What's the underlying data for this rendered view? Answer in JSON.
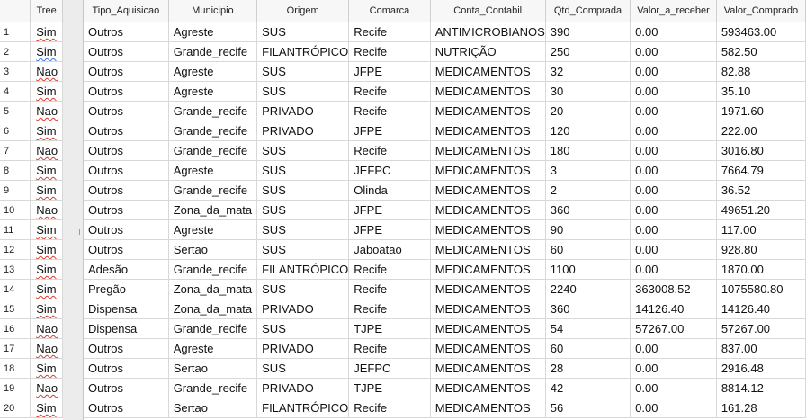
{
  "left_panel": {
    "header": "Tree",
    "rows": [
      {
        "n": "1",
        "v": "Sim"
      },
      {
        "n": "2",
        "v": "Sim"
      },
      {
        "n": "3",
        "v": "Nao"
      },
      {
        "n": "4",
        "v": "Sim"
      },
      {
        "n": "5",
        "v": "Nao"
      },
      {
        "n": "6",
        "v": "Sim"
      },
      {
        "n": "7",
        "v": "Nao"
      },
      {
        "n": "8",
        "v": "Sim"
      },
      {
        "n": "9",
        "v": "Sim"
      },
      {
        "n": "10",
        "v": "Nao"
      },
      {
        "n": "11",
        "v": "Sim"
      },
      {
        "n": "12",
        "v": "Sim"
      },
      {
        "n": "13",
        "v": "Sim"
      },
      {
        "n": "14",
        "v": "Sim"
      },
      {
        "n": "15",
        "v": "Sim"
      },
      {
        "n": "16",
        "v": "Nao"
      },
      {
        "n": "17",
        "v": "Nao"
      },
      {
        "n": "18",
        "v": "Sim"
      },
      {
        "n": "19",
        "v": "Nao"
      },
      {
        "n": "20",
        "v": "Sim"
      }
    ]
  },
  "table": {
    "columns": [
      "Tipo_Aquisicao",
      "Municipio",
      "Origem",
      "Comarca",
      "Conta_Contabil",
      "Qtd_Comprada",
      "Valor_a_receber",
      "Valor_Comprado"
    ],
    "rows": [
      [
        "Outros",
        "Agreste",
        "SUS",
        "Recife",
        "ANTIMICROBIANOS",
        "390",
        "0.00",
        "593463.00"
      ],
      [
        "Outros",
        "Grande_recife",
        "FILANTRÓPICO",
        "Recife",
        "NUTRIÇÃO",
        "250",
        "0.00",
        "582.50"
      ],
      [
        "Outros",
        "Agreste",
        "SUS",
        "JFPE",
        "MEDICAMENTOS",
        "32",
        "0.00",
        "82.88"
      ],
      [
        "Outros",
        "Agreste",
        "SUS",
        "Recife",
        "MEDICAMENTOS",
        "30",
        "0.00",
        "35.10"
      ],
      [
        "Outros",
        "Grande_recife",
        "PRIVADO",
        "Recife",
        "MEDICAMENTOS",
        "20",
        "0.00",
        "1971.60"
      ],
      [
        "Outros",
        "Grande_recife",
        "PRIVADO",
        "JFPE",
        "MEDICAMENTOS",
        "120",
        "0.00",
        "222.00"
      ],
      [
        "Outros",
        "Grande_recife",
        "SUS",
        "Recife",
        "MEDICAMENTOS",
        "180",
        "0.00",
        "3016.80"
      ],
      [
        "Outros",
        "Agreste",
        "SUS",
        "JEFPC",
        "MEDICAMENTOS",
        "3",
        "0.00",
        "7664.79"
      ],
      [
        "Outros",
        "Grande_recife",
        "SUS",
        "Olinda",
        "MEDICAMENTOS",
        "2",
        "0.00",
        "36.52"
      ],
      [
        "Outros",
        "Zona_da_mata",
        "SUS",
        "JFPE",
        "MEDICAMENTOS",
        "360",
        "0.00",
        "49651.20"
      ],
      [
        "Outros",
        "Agreste",
        "SUS",
        "JFPE",
        "MEDICAMENTOS",
        "90",
        "0.00",
        "117.00"
      ],
      [
        "Outros",
        "Sertao",
        "SUS",
        "Jaboatao",
        "MEDICAMENTOS",
        "60",
        "0.00",
        "928.80"
      ],
      [
        "Adesão",
        "Grande_recife",
        "FILANTRÓPICO",
        "Recife",
        "MEDICAMENTOS",
        "1100",
        "0.00",
        "1870.00"
      ],
      [
        "Pregão",
        "Zona_da_mata",
        "SUS",
        "Recife",
        "MEDICAMENTOS",
        "2240",
        "363008.52",
        "1075580.80"
      ],
      [
        "Dispensa",
        "Zona_da_mata",
        "PRIVADO",
        "Recife",
        "MEDICAMENTOS",
        "360",
        "14126.40",
        "14126.40"
      ],
      [
        "Dispensa",
        "Grande_recife",
        "SUS",
        "TJPE",
        "MEDICAMENTOS",
        "54",
        "57267.00",
        "57267.00"
      ],
      [
        "Outros",
        "Agreste",
        "PRIVADO",
        "Recife",
        "MEDICAMENTOS",
        "60",
        "0.00",
        "837.00"
      ],
      [
        "Outros",
        "Sertao",
        "SUS",
        "JEFPC",
        "MEDICAMENTOS",
        "28",
        "0.00",
        "2916.48"
      ],
      [
        "Outros",
        "Grande_recife",
        "PRIVADO",
        "TJPE",
        "MEDICAMENTOS",
        "42",
        "0.00",
        "8814.12"
      ],
      [
        "Outros",
        "Sertao",
        "FILANTRÓPICO",
        "Recife",
        "MEDICAMENTOS",
        "56",
        "0.00",
        "161.28"
      ]
    ]
  },
  "colors": {
    "grid": "#d8d8d8",
    "header_bg": "#f7f7f7",
    "spell_red": "#d93a2b",
    "spell_blue": "#3a74d9"
  }
}
